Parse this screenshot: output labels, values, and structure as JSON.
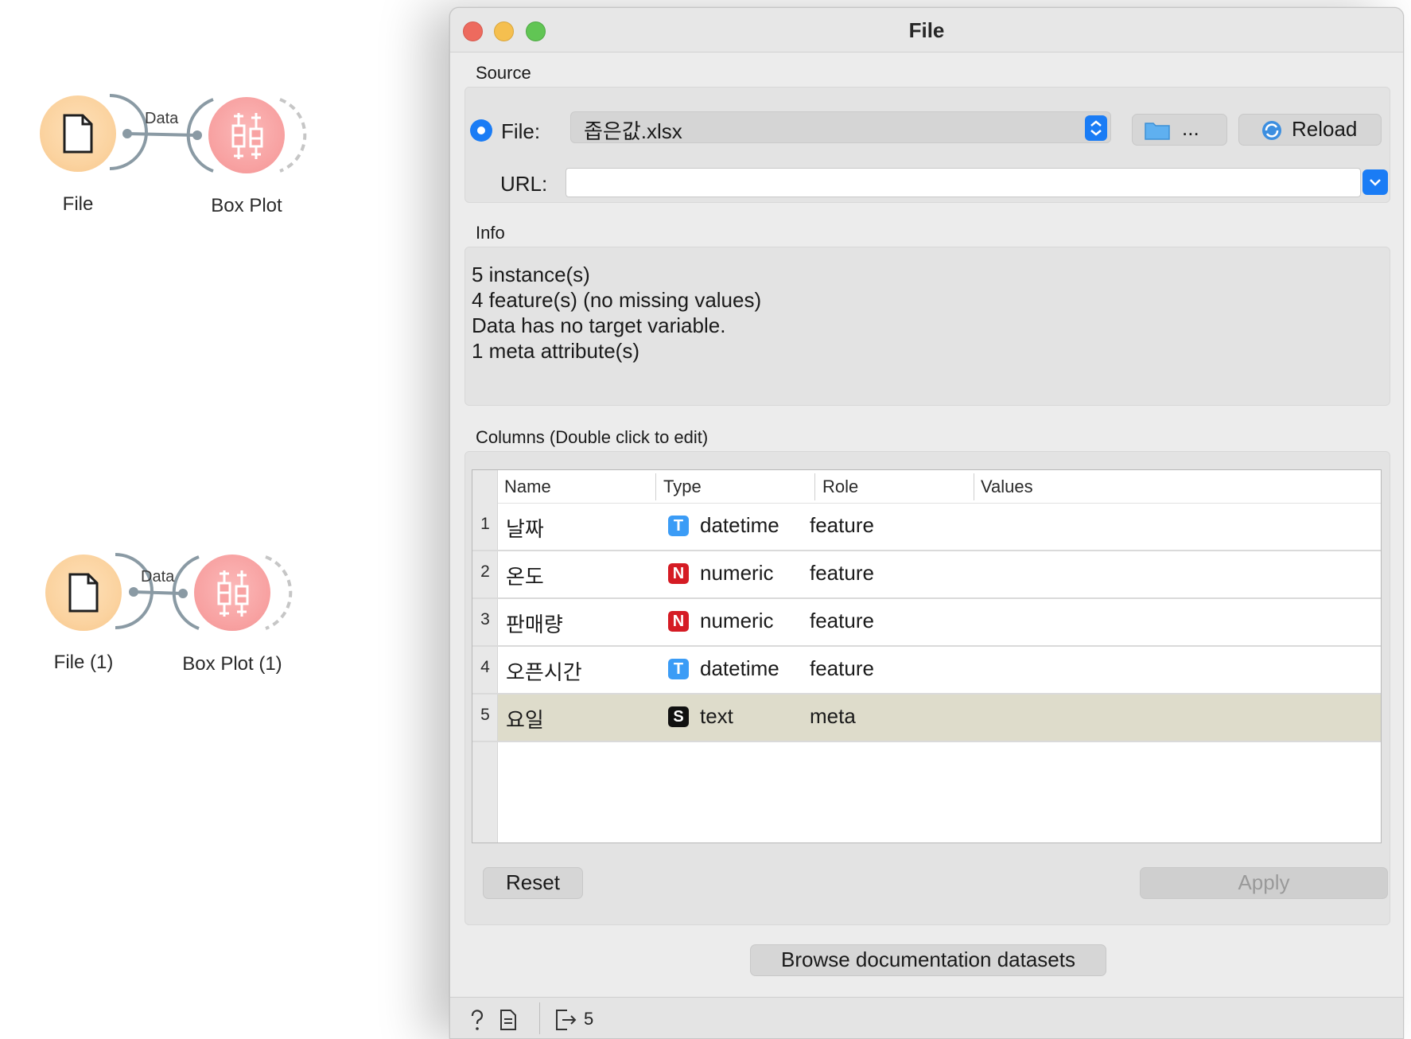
{
  "canvas": {
    "workflows": [
      {
        "file_label": "File",
        "link_label": "Data",
        "boxplot_label": "Box Plot"
      },
      {
        "file_label": "File (1)",
        "link_label": "Data",
        "boxplot_label": "Box Plot (1)"
      }
    ]
  },
  "window": {
    "title": "File",
    "source": {
      "section": "Source",
      "file_label": "File:",
      "file_value": "좁은값.xlsx",
      "browse_label": "...",
      "reload_label": "Reload",
      "url_label": "URL:",
      "url_value": ""
    },
    "info": {
      "section": "Info",
      "lines": [
        "5 instance(s)",
        "4 feature(s) (no missing values)",
        "Data has no target variable.",
        "1 meta attribute(s)"
      ]
    },
    "columns": {
      "section": "Columns (Double click to edit)",
      "headers": [
        "Name",
        "Type",
        "Role",
        "Values"
      ],
      "rows": [
        {
          "num": "1",
          "name": "날짜",
          "type_badge": "T",
          "type": "datetime",
          "role": "feature",
          "values": "",
          "badge_color": "#3b9cf6"
        },
        {
          "num": "2",
          "name": "온도",
          "type_badge": "N",
          "type": "numeric",
          "role": "feature",
          "values": "",
          "badge_color": "#d51b24"
        },
        {
          "num": "3",
          "name": "판매량",
          "type_badge": "N",
          "type": "numeric",
          "role": "feature",
          "values": "",
          "badge_color": "#d51b24"
        },
        {
          "num": "4",
          "name": "오픈시간",
          "type_badge": "T",
          "type": "datetime",
          "role": "feature",
          "values": "",
          "badge_color": "#3b9cf6"
        },
        {
          "num": "5",
          "name": "요일",
          "type_badge": "S",
          "type": "text",
          "role": "meta",
          "values": "",
          "badge_color": "#111111"
        }
      ]
    },
    "reset_label": "Reset",
    "apply_label": "Apply",
    "browse_docs_label": "Browse documentation datasets",
    "footer": {
      "output_count": "5"
    }
  },
  "colors": {
    "accent": "#1a7cf5",
    "file_node": "#fbd3a0",
    "boxplot_node": "#f8a3a3",
    "selected_row": "#dedccb"
  }
}
